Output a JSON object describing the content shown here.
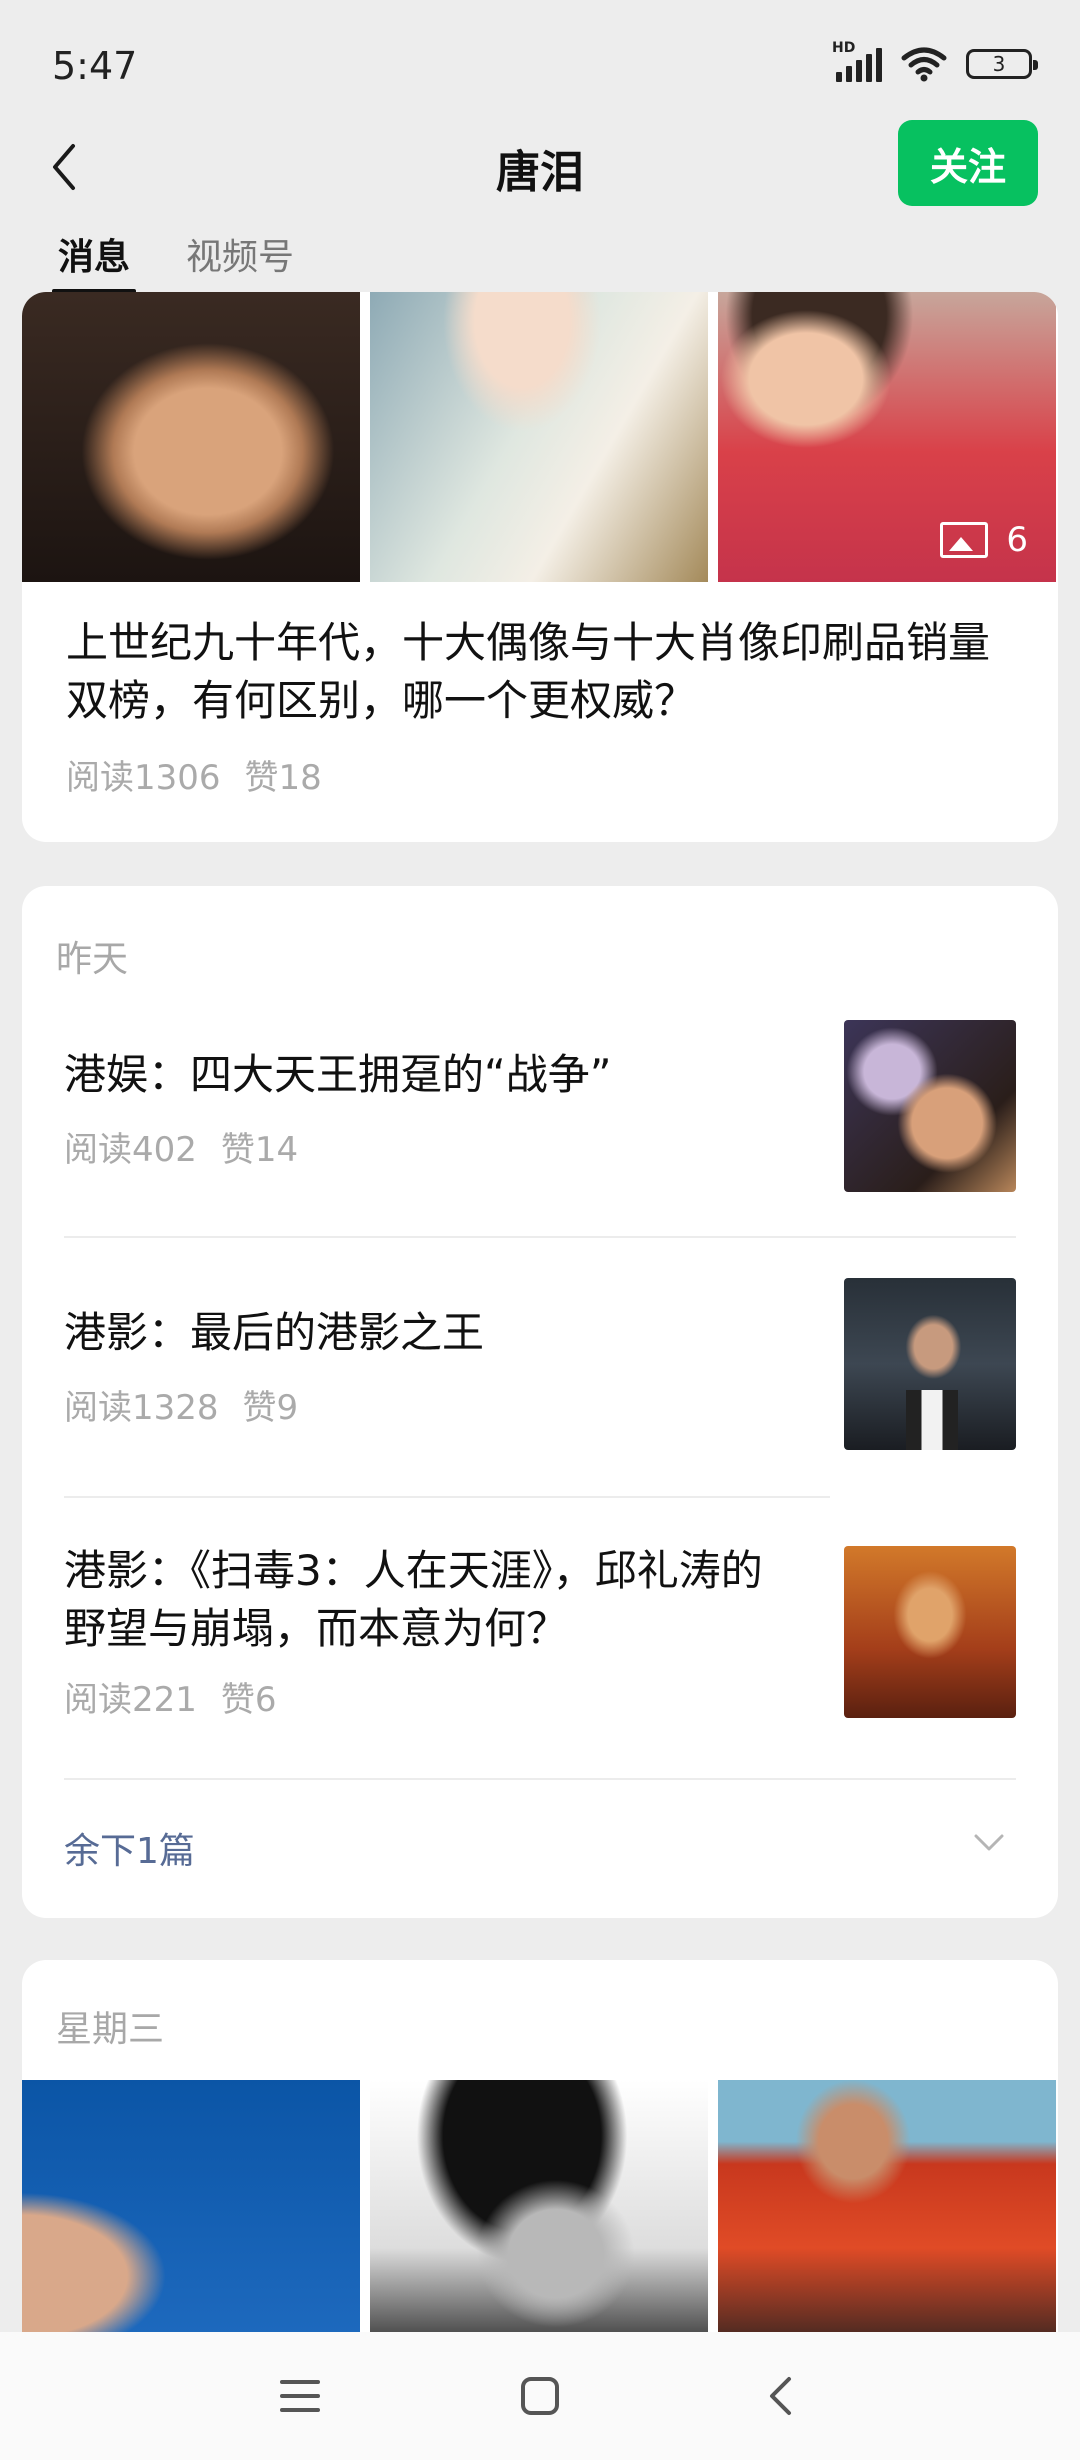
{
  "status_bar": {
    "time": "5:47",
    "network_label": "HD",
    "battery": "3"
  },
  "header": {
    "title": "唐泪",
    "follow_label": "关注",
    "back_icon": "chevron-left-icon"
  },
  "tabs": [
    {
      "label": "消息",
      "active": true
    },
    {
      "label": "视频号",
      "active": false
    }
  ],
  "top_card": {
    "image_count": "6",
    "title": "上世纪九十年代，十大偶像与十大肖像印刷品销量双榜，有何区别，哪一个更权威？",
    "reads": "阅读1306",
    "likes": "赞18"
  },
  "yesterday": {
    "label": "昨天",
    "items": [
      {
        "title": "港娱：四大天王拥趸的“战争”",
        "reads": "阅读402",
        "likes": "赞14"
      },
      {
        "title": "港影：最后的港影之王",
        "reads": "阅读1328",
        "likes": "赞9"
      },
      {
        "title": "港影：《扫毒3：人在天涯》，邱礼涛的野望与崩塌，而本意为何？",
        "reads": "阅读221",
        "likes": "赞6"
      }
    ],
    "more_label": "余下1篇"
  },
  "wednesday": {
    "label": "星期三"
  },
  "colors": {
    "accent": "#07c160",
    "link": "#576b95",
    "meta": "#aaaaaa"
  }
}
